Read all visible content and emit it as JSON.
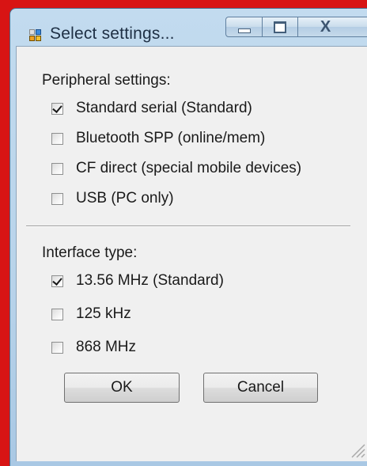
{
  "window": {
    "title": "Select settings...",
    "close_glyph": "X",
    "icons": [
      "app-icon",
      "minimize-icon",
      "maximize-icon",
      "close-icon",
      "resize-grip-icon"
    ]
  },
  "peripheral": {
    "label": "Peripheral settings:",
    "options": [
      {
        "label": "Standard serial (Standard)",
        "checked": true
      },
      {
        "label": "Bluetooth SPP (online/mem)",
        "checked": false
      },
      {
        "label": "CF direct (special mobile devices)",
        "checked": false
      },
      {
        "label": "USB (PC only)",
        "checked": false
      }
    ]
  },
  "interface": {
    "label": "Interface type:",
    "options": [
      {
        "label": "13.56 MHz (Standard)",
        "checked": true
      },
      {
        "label": "125 kHz",
        "checked": false
      },
      {
        "label": "868 MHz",
        "checked": false
      }
    ]
  },
  "buttons": {
    "ok": "OK",
    "cancel": "Cancel"
  },
  "colors": {
    "background": "#d81414",
    "frame": "#b8d3ea",
    "client": "#f0f0f0"
  }
}
